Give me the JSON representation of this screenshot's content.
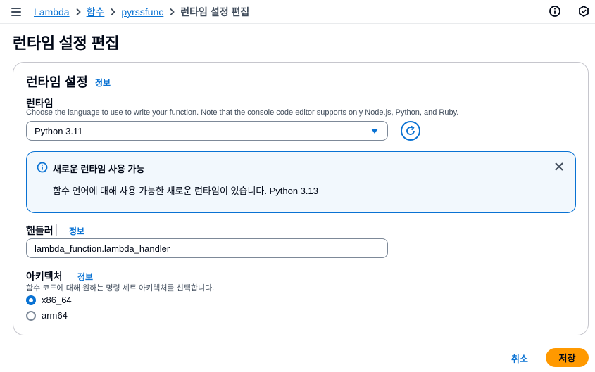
{
  "breadcrumb": {
    "items": [
      "Lambda",
      "함수",
      "pyrssfunc"
    ],
    "current": "런타임 설정 편집"
  },
  "page": {
    "title": "런타임 설정 편집"
  },
  "panel": {
    "title": "런타임 설정",
    "info_label": "정보",
    "runtime": {
      "label": "런타임",
      "description": "Choose the language to use to write your function. Note that the console code editor supports only Node.js, Python, and Ruby.",
      "selected": "Python 3.11"
    },
    "alert": {
      "title": "새로운 런타임 사용 가능",
      "body": "함수 언어에 대해 사용 가능한 새로운 런타임이 있습니다. Python 3.13"
    },
    "handler": {
      "label": "핸들러",
      "info_label": "정보",
      "value": "lambda_function.lambda_handler"
    },
    "architecture": {
      "label": "아키텍처",
      "info_label": "정보",
      "description": "함수 코드에 대해 원하는 명령 세트 아키텍처를 선택합니다.",
      "options": [
        "x86_64",
        "arm64"
      ],
      "selected": "x86_64"
    }
  },
  "actions": {
    "cancel": "취소",
    "save": "저장"
  },
  "colors": {
    "accent": "#0972d3",
    "primary_button": "#ff9900",
    "alert_bg": "#f2f8fd"
  }
}
